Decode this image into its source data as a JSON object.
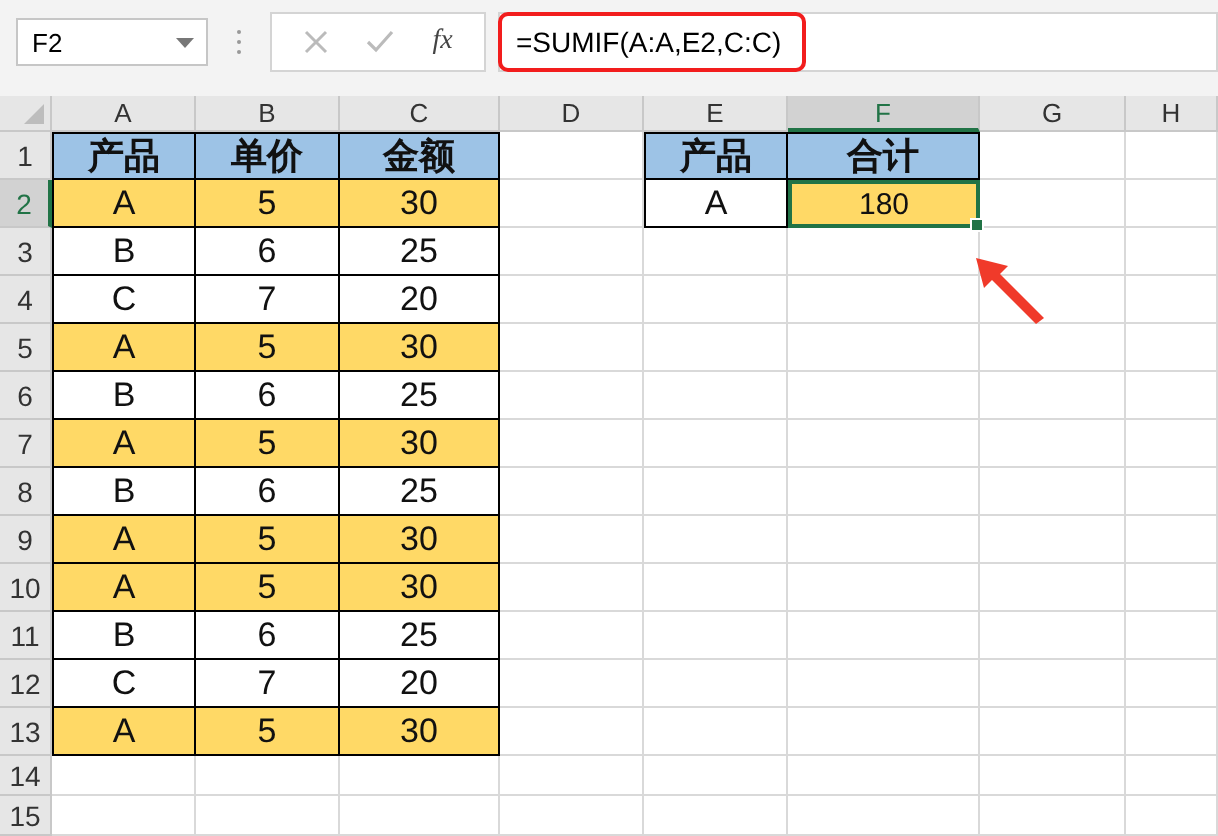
{
  "name_box": "F2",
  "formula_bar": {
    "function_label": "fx",
    "formula": "=SUMIF(A:A,E2,C:C)"
  },
  "columns": [
    {
      "label": "A",
      "selected": false
    },
    {
      "label": "B",
      "selected": false
    },
    {
      "label": "C",
      "selected": false
    },
    {
      "label": "D",
      "selected": false
    },
    {
      "label": "E",
      "selected": false
    },
    {
      "label": "F",
      "selected": true
    },
    {
      "label": "G",
      "selected": false
    },
    {
      "label": "H",
      "selected": false
    }
  ],
  "row_headers": [
    {
      "label": "1",
      "selected": false
    },
    {
      "label": "2",
      "selected": true
    },
    {
      "label": "3",
      "selected": false
    },
    {
      "label": "4",
      "selected": false
    },
    {
      "label": "5",
      "selected": false
    },
    {
      "label": "6",
      "selected": false
    },
    {
      "label": "7",
      "selected": false
    },
    {
      "label": "8",
      "selected": false
    },
    {
      "label": "9",
      "selected": false
    },
    {
      "label": "10",
      "selected": false
    },
    {
      "label": "11",
      "selected": false
    },
    {
      "label": "12",
      "selected": false
    },
    {
      "label": "13",
      "selected": false
    },
    {
      "label": "14",
      "selected": false
    },
    {
      "label": "15",
      "selected": false
    }
  ],
  "tables": [
    {
      "header": [
        "产品",
        "单价",
        "金额"
      ],
      "rows": [
        {
          "values": [
            "A",
            "5",
            "30"
          ],
          "highlighted": true
        },
        {
          "values": [
            "B",
            "6",
            "25"
          ],
          "highlighted": false
        },
        {
          "values": [
            "C",
            "7",
            "20"
          ],
          "highlighted": false
        },
        {
          "values": [
            "A",
            "5",
            "30"
          ],
          "highlighted": true
        },
        {
          "values": [
            "B",
            "6",
            "25"
          ],
          "highlighted": false
        },
        {
          "values": [
            "A",
            "5",
            "30"
          ],
          "highlighted": true
        },
        {
          "values": [
            "B",
            "6",
            "25"
          ],
          "highlighted": false
        },
        {
          "values": [
            "A",
            "5",
            "30"
          ],
          "highlighted": true
        },
        {
          "values": [
            "A",
            "5",
            "30"
          ],
          "highlighted": true
        },
        {
          "values": [
            "B",
            "6",
            "25"
          ],
          "highlighted": false
        },
        {
          "values": [
            "C",
            "7",
            "20"
          ],
          "highlighted": false
        },
        {
          "values": [
            "A",
            "5",
            "30"
          ],
          "highlighted": true
        }
      ]
    },
    {
      "header": [
        "产品",
        "合计"
      ],
      "rows": [
        {
          "cells": [
            {
              "text": "A",
              "highlighted": false,
              "selected": false
            },
            {
              "text": "180",
              "highlighted": true,
              "selected": true
            }
          ]
        }
      ]
    }
  ]
}
